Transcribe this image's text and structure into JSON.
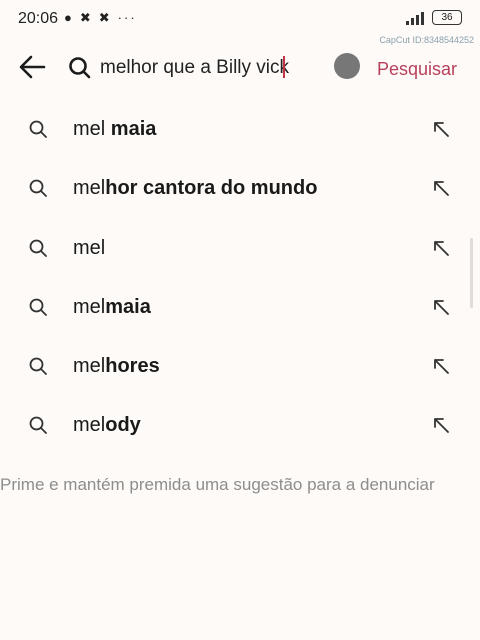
{
  "status_bar": {
    "time": "20:06",
    "battery": "36",
    "watermark": "CapCut ID:8348544252"
  },
  "search": {
    "query": "melhor que a Billy vick",
    "submit_label": "Pesquisar",
    "accent_color": "#b8405a"
  },
  "suggestions": [
    {
      "prefix": "mel ",
      "bold": "maia"
    },
    {
      "prefix": "mel",
      "bold": "hor cantora do mundo"
    },
    {
      "prefix": "mel",
      "bold": ""
    },
    {
      "prefix": "mel",
      "bold": "maia"
    },
    {
      "prefix": "mel",
      "bold": "hores"
    },
    {
      "prefix": "mel",
      "bold": "ody"
    }
  ],
  "hint": "Prime e mantém premida uma sugestão para a denunciar"
}
